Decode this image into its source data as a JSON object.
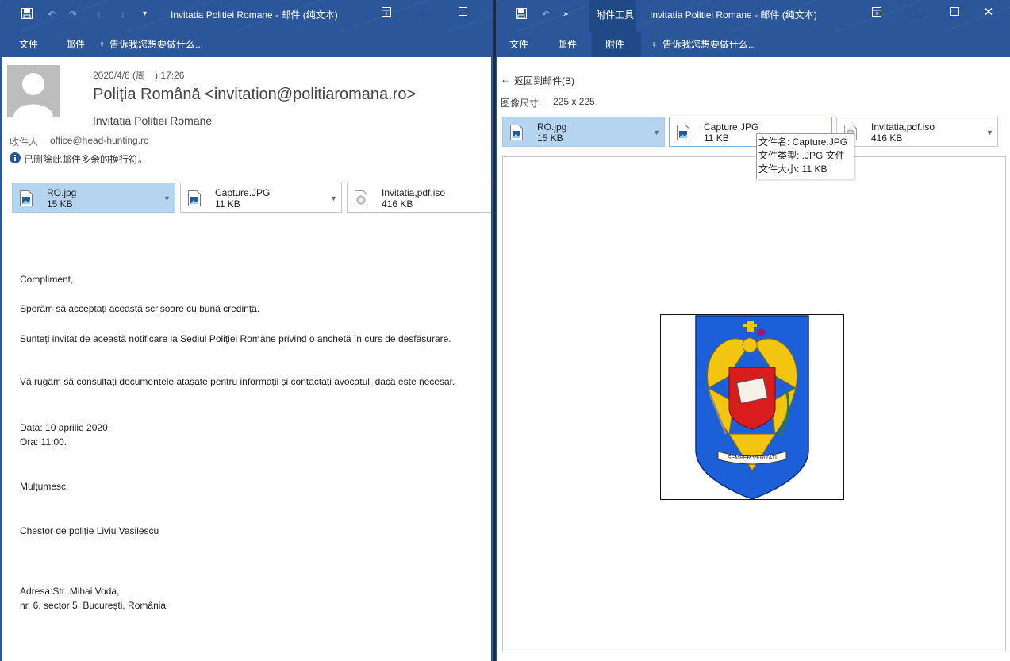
{
  "colors": {
    "titlebar": "#2b579a",
    "selected_attachment": "#b4d4ef",
    "emblem_blue": "#1d5fd9",
    "emblem_gold": "#f2c511",
    "emblem_red": "#d91c1c"
  },
  "left_window": {
    "title": "Invitatia Politiei Romane - 邮件 (纯文本)",
    "menu": {
      "file": "文件",
      "mail": "邮件",
      "tell_me": "告诉我您想要做什么..."
    },
    "message": {
      "date": "2020/4/6 (周一) 17:26",
      "sender": "Poliția Română <invitation@politiaromana.ro>",
      "subject": "Invitatia Politiei Romane",
      "to_label": "收件人",
      "to_value": "office@head-hunting.ro",
      "info": "已删除此邮件多余的换行符。"
    },
    "attachments": [
      {
        "name": "RO.jpg",
        "size": "15 KB"
      },
      {
        "name": "Capture.JPG",
        "size": "11 KB"
      },
      {
        "name": "Invitatia,pdf.iso",
        "size": "416 KB"
      }
    ],
    "body": {
      "greeting": "Compliment,",
      "p1": "Sperăm să acceptați această scrisoare cu bună credință.",
      "p2": "Sunteți invitat de această notificare la Sediul Poliției Române privind o anchetă în curs de desfășurare.",
      "p3": "Vă rugăm să consultați documentele atașate pentru informații și contactați avocatul, dacă este necesar.",
      "date": "Data: 10 aprilie 2020.",
      "time": "Ora: 11:00.",
      "thanks": "Mulțumesc,",
      "signature": "Chestor de poliție Liviu Vasilescu",
      "address1": "Adresa:Str. Mihai Voda,",
      "address2": "nr. 6, sector 5, București, România"
    }
  },
  "right_window": {
    "context_tab": "附件工具",
    "title": "Invitatia Politiei Romane - 邮件 (纯文本)",
    "menu": {
      "file": "文件",
      "mail": "邮件",
      "attachment": "附件",
      "tell_me": "告诉我您想要做什么..."
    },
    "back": "返回到邮件(B)",
    "image_size_label": "图像尺寸:",
    "image_size_value": "225 x 225",
    "attachments": [
      {
        "name": "RO.jpg",
        "size": "15 KB"
      },
      {
        "name": "Capture.JPG",
        "size": "11 KB"
      },
      {
        "name": "Invitatia,pdf.iso",
        "size": "416 KB"
      }
    ],
    "tooltip": {
      "file_name": "文件名: Capture.JPG",
      "file_type": "文件类型: .JPG 文件",
      "file_size": "文件大小: 11 KB"
    },
    "emblem": {
      "motto": "SEMPER VERITATI"
    }
  }
}
